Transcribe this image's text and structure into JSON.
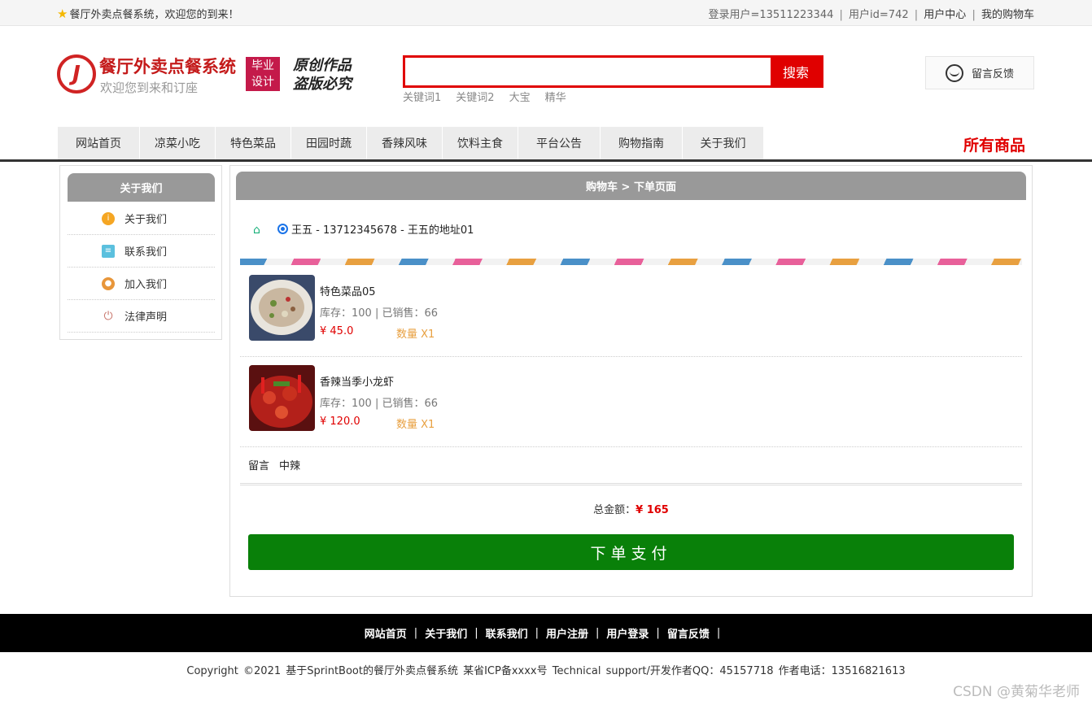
{
  "topbar": {
    "welcome": "餐厅外卖点餐系统，欢迎您的到来！",
    "login_user": "登录用户=13511223344",
    "user_id": "用户id=742",
    "user_center": "用户中心",
    "my_cart": "我的购物车",
    "sep": "|"
  },
  "header": {
    "logo_title": "餐厅外卖点餐系统",
    "logo_sub": "欢迎您到来和订座",
    "badge_line1": "毕业",
    "badge_line2": "设计",
    "orig_line1": "原创作品",
    "orig_line2": "盗版必究",
    "search_placeholder": "",
    "search_button": "搜索",
    "keywords": [
      "关键词1",
      "关键词2",
      "大宝",
      "精华"
    ],
    "feedback": "留言反馈"
  },
  "nav": {
    "items": [
      "网站首页",
      "凉菜小吃",
      "特色菜品",
      "田园时蔬",
      "香辣风味",
      "饮料主食",
      "平台公告",
      "购物指南",
      "关于我们"
    ],
    "all_goods": "所有商品"
  },
  "sidebar": {
    "title": "关于我们",
    "items": [
      {
        "label": "关于我们",
        "icon": "info-icon",
        "color": "#f5a623"
      },
      {
        "label": "联系我们",
        "icon": "clipboard-icon",
        "color": "#5bc0de"
      },
      {
        "label": "加入我们",
        "icon": "lock-icon",
        "color": "#e8963a"
      },
      {
        "label": "法律声明",
        "icon": "power-icon",
        "color": "#c9786e"
      }
    ]
  },
  "main": {
    "title": "购物车 > 下单页面",
    "address": "王五 - 13712345678 - 王五的地址01",
    "products": [
      {
        "name": "特色菜品05",
        "stock": "库存：100 | 已销售：66",
        "price": "¥ 45.0",
        "qty": "数量 X1"
      },
      {
        "name": "香辣当季小龙虾",
        "stock": "库存：100 | 已销售：66",
        "price": "¥ 120.0",
        "qty": "数量 X1"
      }
    ],
    "remark_label": "留言",
    "remark_value": "中辣",
    "total_label": "总金额：",
    "total_amount": "¥ 165",
    "pay_button": "下单支付"
  },
  "footer": {
    "links": [
      "网站首页",
      "关于我们",
      "联系我们",
      "用户注册",
      "用户登录",
      "留言反馈"
    ],
    "sep": "|",
    "copyright": "Copyright ©2021 基于SprintBoot的餐厅外卖点餐系统    某省ICP备xxxx号    Technical support/开发作者QQ：45157718    作者电话：13516821613"
  },
  "watermark": "CSDN @黄菊华老师",
  "colors": {
    "accent_red": "#e00000",
    "pay_green": "#098009",
    "panel_gray": "#999999"
  }
}
